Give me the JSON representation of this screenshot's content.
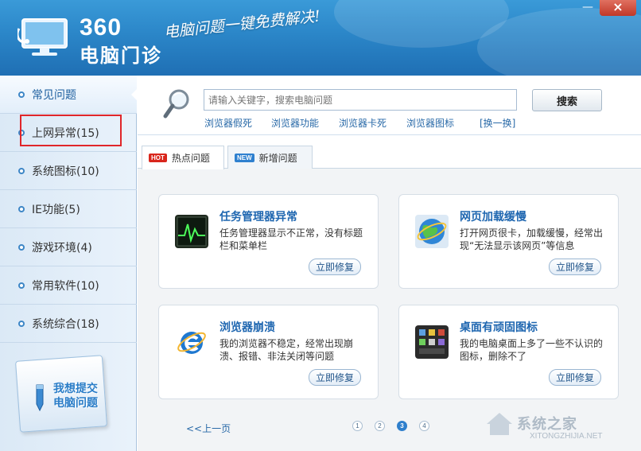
{
  "app": {
    "logo_number": "360",
    "logo_name": "电脑门诊",
    "slogan": "电脑问题一键免费解决!"
  },
  "window": {
    "minimize": "—",
    "close": "×"
  },
  "sidebar": {
    "items": [
      {
        "label": "常见问题"
      },
      {
        "label": "上网异常(15)"
      },
      {
        "label": "系统图标(10)"
      },
      {
        "label": "IE功能(5)"
      },
      {
        "label": "游戏环境(4)"
      },
      {
        "label": "常用软件(10)"
      },
      {
        "label": "系统综合(18)"
      }
    ],
    "submit_line1": "我想提交",
    "submit_line2": "电脑问题"
  },
  "search": {
    "placeholder": "请输入关键字，搜索电脑问题",
    "button_label": "搜索",
    "hot_links": [
      "浏览器假死",
      "浏览器功能",
      "浏览器卡死",
      "浏览器图标",
      "[换一换]"
    ]
  },
  "tabs": [
    {
      "badge": "HOT",
      "label": "热点问题"
    },
    {
      "badge": "NEW",
      "label": "新增问题"
    }
  ],
  "cards": [
    {
      "title": "任务管理器异常",
      "desc": "任务管理器显示不正常，没有标题栏和菜单栏",
      "button": "立即修复",
      "icon": "task-manager-icon"
    },
    {
      "title": "网页加载缓慢",
      "desc": "打开网页很卡，加载缓慢，经常出现“无法显示该网页”等信息",
      "button": "立即修复",
      "icon": "globe-icon"
    },
    {
      "title": "浏览器崩溃",
      "desc": "我的浏览器不稳定，经常出现崩溃、报错、非法关闭等问题",
      "button": "立即修复",
      "icon": "ie-icon"
    },
    {
      "title": "桌面有顽固图标",
      "desc": "我的电脑桌面上多了一些不认识的图标，删除不了",
      "button": "立即修复",
      "icon": "desktop-icons-icon"
    }
  ],
  "pagination": {
    "prev": "<<上一页",
    "pages": [
      "1",
      "2",
      "3",
      "4"
    ],
    "current": "3"
  },
  "watermark": {
    "text": "系统之家",
    "url": "XITONGZHIJIA.NET"
  },
  "colors": {
    "header_blue": "#2b86c8",
    "link_blue": "#2a6aa8",
    "highlight_red": "#e0262a",
    "hot_red": "#d9261c"
  }
}
